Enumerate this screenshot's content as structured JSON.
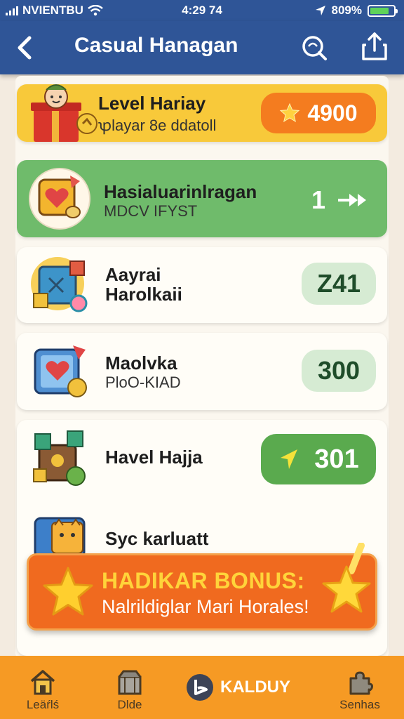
{
  "status_bar": {
    "carrier": "NVIENTBU",
    "time": "4:29 74",
    "battery_percent": "809%",
    "battery_level": 0.8
  },
  "header": {
    "title": "Casual Hanagan",
    "icons": [
      "back-chevron-icon",
      "search-icon",
      "share-icon"
    ]
  },
  "level_card": {
    "title": "Level Hariay",
    "subtitle": "ꝕlayar 8e ddatoll",
    "score": "4900",
    "score_icon": "star-icon"
  },
  "items": [
    {
      "name": "Hasialuarinlragan",
      "sub": "MDCV IFYST",
      "value": "1",
      "icon": "fast-forward-icon",
      "highlight": true
    },
    {
      "name": "Aayrai",
      "sub": "Harolkaii",
      "value": "Z41",
      "icon": "",
      "highlight": false
    },
    {
      "name": "Maolvka",
      "sub": "PloO-KIAD",
      "value": "300",
      "icon": "",
      "highlight": false
    },
    {
      "name": "Havel Hajja",
      "sub": "",
      "value": "301",
      "icon": "arrow-cursor-icon",
      "highlight": true
    },
    {
      "name": "Syc karluatt",
      "sub": "",
      "value": "",
      "icon": "",
      "highlight": false
    }
  ],
  "bonus_banner": {
    "headline": "HADIKAR BONUS:",
    "subline": "Nalrildiglar Mari Horales!",
    "icon": "star-icon"
  },
  "bottom_nav": {
    "tabs": [
      {
        "label": "Leäŕlś",
        "icon": "home-icon"
      },
      {
        "label": "Dlde",
        "icon": "shop-icon"
      },
      {
        "label": "KALDUY",
        "icon": "play-icon"
      },
      {
        "label": "Senhas",
        "icon": "puzzle-icon"
      }
    ]
  },
  "colors": {
    "header": "#2f5597",
    "level_card": "#f8c93a",
    "score_pill": "#f47c1f",
    "highlight_card": "#6fbb6b",
    "value_pill": "#d6ebd3",
    "value_text": "#1f4d2a",
    "bonus_banner": "#f06a1f",
    "bottom_nav": "#f69a24"
  }
}
